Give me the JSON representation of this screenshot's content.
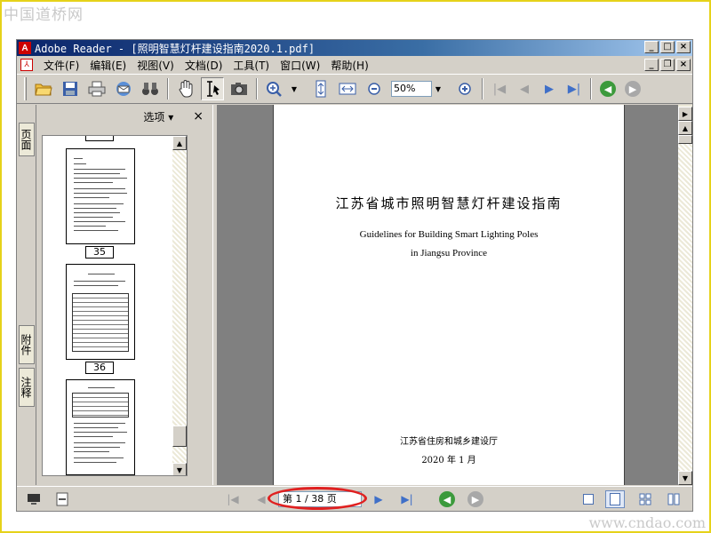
{
  "watermarks": {
    "top": "中国道桥网",
    "bottom": "www.cndao.com"
  },
  "window": {
    "title": "Adobe Reader - [照明智慧灯杆建设指南2020.1.pdf]"
  },
  "menu": [
    {
      "label": "文件(F)"
    },
    {
      "label": "编辑(E)"
    },
    {
      "label": "视图(V)"
    },
    {
      "label": "文档(D)"
    },
    {
      "label": "工具(T)"
    },
    {
      "label": "窗口(W)"
    },
    {
      "label": "帮助(H)"
    }
  ],
  "toolbar": {
    "zoom_value": "50%"
  },
  "side_tabs": {
    "pages": "页面",
    "attachments": "附件",
    "comments": "注释"
  },
  "nav_pane": {
    "options_label": "选项 ▾",
    "close_label": "×"
  },
  "thumbnails": [
    {
      "page_label": "35"
    },
    {
      "page_label": "36"
    }
  ],
  "document": {
    "title_cn": "江苏省城市照明智慧灯杆建设指南",
    "title_en_line1": "Guidelines for Building Smart Lighting Poles",
    "title_en_line2": "in Jiangsu Province",
    "department": "江苏省住房和城乡建设厅",
    "date": "2020 年 1 月"
  },
  "statusbar": {
    "page_indicator": "第 1 / 38 页"
  },
  "colors": {
    "title_gradient_start": "#0a246a",
    "highlight_ellipse": "#e02020",
    "frame_border": "#e6d21a"
  }
}
